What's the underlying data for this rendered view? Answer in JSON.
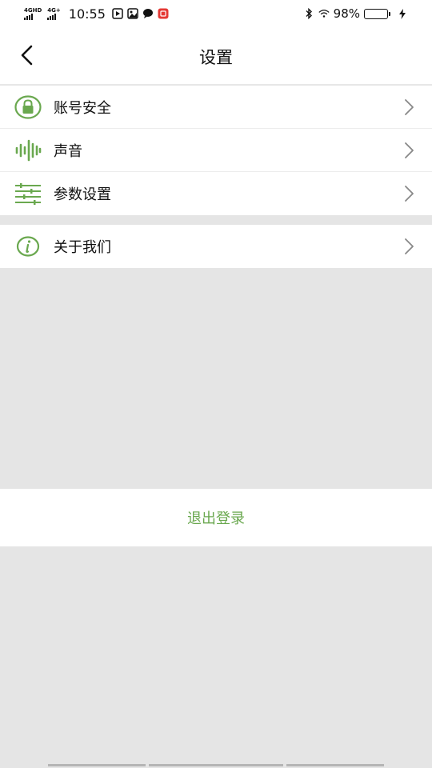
{
  "status_bar": {
    "net1": "4GHD",
    "net2": "4G+",
    "time": "10:55",
    "battery": "98%",
    "battery_level": 0.98,
    "icons": [
      "play-icon",
      "photo-app-icon",
      "chat-bubble-icon",
      "red-app-icon",
      "bluetooth-icon",
      "wifi-icon",
      "battery-icon",
      "charging-icon"
    ]
  },
  "nav": {
    "title": "设置",
    "back_icon": "chevron-left-icon"
  },
  "menu": {
    "group1": [
      {
        "label": "账号安全",
        "icon": "lock-icon"
      },
      {
        "label": "声音",
        "icon": "sound-wave-icon"
      },
      {
        "label": "参数设置",
        "icon": "sliders-icon"
      }
    ],
    "group2": [
      {
        "label": "关于我们",
        "icon": "info-icon"
      }
    ]
  },
  "logout": {
    "label": "退出登录"
  },
  "colors": {
    "accent": "#6aa84f",
    "background": "#e5e5e5",
    "surface": "#ffffff",
    "text": "#111111",
    "chevron": "#888888"
  }
}
